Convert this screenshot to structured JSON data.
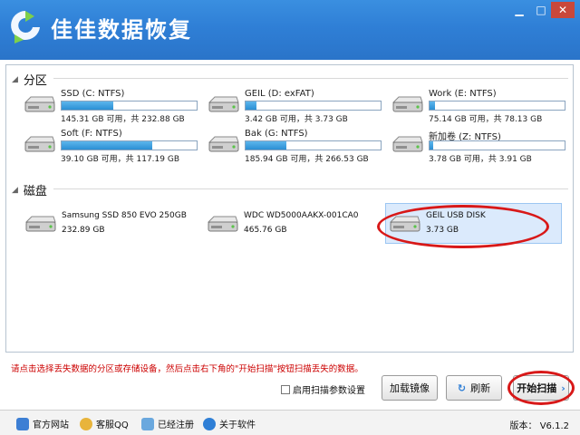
{
  "app": {
    "title": "佳佳数据恢复"
  },
  "window": {
    "minimize_glyph": "▁",
    "maximize_glyph": "□",
    "close_glyph": "✕"
  },
  "sections": {
    "partitions": "分区",
    "disks": "磁盘"
  },
  "partitions": [
    {
      "name": "SSD (C: NTFS)",
      "size": "145.31 GB 可用，共 232.88 GB",
      "used_fraction": 0.38
    },
    {
      "name": "GEIL (D: exFAT)",
      "size": "3.42 GB 可用，共 3.73 GB",
      "used_fraction": 0.08
    },
    {
      "name": "Work (E: NTFS)",
      "size": "75.14 GB 可用，共 78.13 GB",
      "used_fraction": 0.04
    },
    {
      "name": "Soft (F: NTFS)",
      "size": "39.10 GB 可用，共 117.19 GB",
      "used_fraction": 0.67
    },
    {
      "name": "Bak (G: NTFS)",
      "size": "185.94 GB 可用，共 266.53 GB",
      "used_fraction": 0.3
    },
    {
      "name": "新加卷 (Z: NTFS)",
      "size": "3.78 GB 可用，共 3.91 GB",
      "used_fraction": 0.03
    }
  ],
  "disks": [
    {
      "name": "Samsung SSD 850 EVO 250GB",
      "size": "232.89 GB",
      "selected": false
    },
    {
      "name": "WDC WD5000AAKX-001CA0",
      "size": "465.76 GB",
      "selected": false
    },
    {
      "name": "GEIL USB DISK",
      "size": "3.73 GB",
      "selected": true
    }
  ],
  "hint": "请点击选择丢失数据的分区或存储设备，然后点击右下角的\"开始扫描\"按钮扫描丢失的数据。",
  "controls": {
    "scan_params_label": "启用扫描参数设置",
    "load_image": "加载镜像",
    "refresh": "刷新",
    "start_scan": "开始扫描"
  },
  "footer": {
    "website": "官方网站",
    "support": "客服QQ",
    "registered": "已经注册",
    "about": "关于软件",
    "version": "版本： V6.1.2"
  },
  "colors": {
    "accent": "#2f7fd6",
    "highlight": "#d81818",
    "hint": "#cc0000"
  }
}
